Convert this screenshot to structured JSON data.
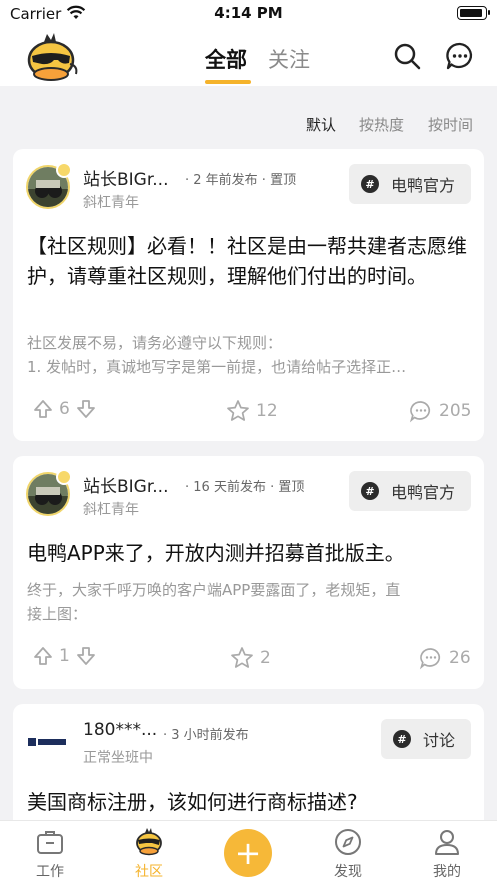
{
  "status_bar": {
    "carrier": "Carrier",
    "time": "4:14 PM"
  },
  "header": {
    "tabs": [
      {
        "label": "全部"
      },
      {
        "label": "关注"
      }
    ]
  },
  "sort": {
    "options": [
      "默认",
      "按热度",
      "按时间"
    ]
  },
  "posts": [
    {
      "author": "站长BIGr...",
      "meta": "· 2 年前发布 · 置顶",
      "title_badge": "斜杠青年",
      "topic": "电鸭官方",
      "title": "【社区规则】必看！！社区是由一帮共建者志愿维护，请尊重社区规则，理解他们付出的时间。",
      "excerpt_lines": [
        "社区发展不易，请务必遵守以下规则：",
        "1. 发帖时，真诚地写字是第一前提，也请给帖子选择正…"
      ],
      "upvotes": "6",
      "favorites": "12",
      "comments": "205"
    },
    {
      "author": "站长BIGr...",
      "meta": "· 16 天前发布 · 置顶",
      "title_badge": "斜杠青年",
      "topic": "电鸭官方",
      "title": "电鸭APP来了，开放内测并招募首批版主。",
      "excerpt_lines": [
        "终于，大家千呼万唤的客户端APP要露面了，老规矩，直",
        "接上图："
      ],
      "upvotes": "1",
      "favorites": "2",
      "comments": "26"
    },
    {
      "author": "180***...",
      "meta": "· 3 小时前发布",
      "title_badge": "正常坐班中",
      "topic": "讨论",
      "title": "美国商标注册，该如何进行商标描述?"
    }
  ],
  "bottom_nav": {
    "items": [
      {
        "label": "工作",
        "icon": "briefcase-icon"
      },
      {
        "label": "社区",
        "icon": "duck-icon"
      },
      {
        "label": "发现",
        "icon": "compass-icon"
      },
      {
        "label": "我的",
        "icon": "person-icon"
      }
    ],
    "add_label": "+"
  },
  "colors": {
    "accent": "#f5b32b",
    "background": "#f2f2f4"
  }
}
